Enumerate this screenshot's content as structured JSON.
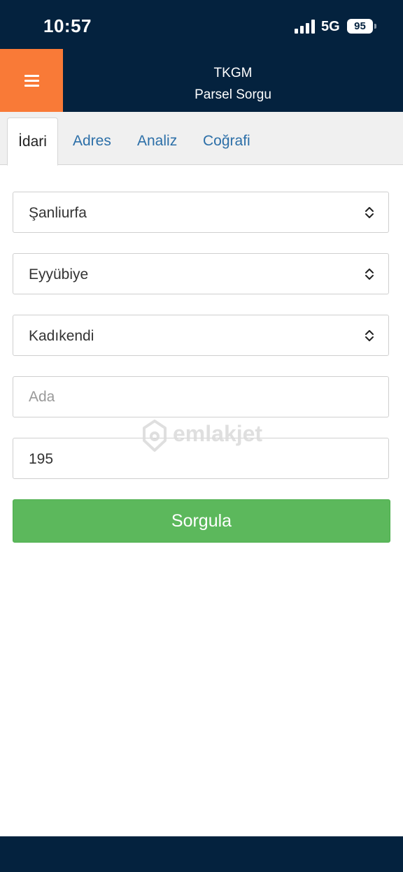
{
  "status": {
    "time": "10:57",
    "network": "5G",
    "battery": "95"
  },
  "header": {
    "menu_icon": "hamburger-icon",
    "title": "TKGM",
    "subtitle": "Parsel Sorgu"
  },
  "tabs": [
    {
      "label": "İdari",
      "active": true
    },
    {
      "label": "Adres",
      "active": false
    },
    {
      "label": "Analiz",
      "active": false
    },
    {
      "label": "Coğrafi",
      "active": false
    }
  ],
  "form": {
    "province": "Şanliurfa",
    "district": "Eyyübiye",
    "neighborhood": "Kadıkendi",
    "block_placeholder": "Ada",
    "block_value": "",
    "parcel_value": "195",
    "submit_label": "Sorgula"
  },
  "watermark": {
    "text": "emlakjet"
  },
  "colors": {
    "navy": "#04223e",
    "orange": "#f97a37",
    "green": "#5cb85c",
    "tab_blue": "#2c6fa8"
  }
}
